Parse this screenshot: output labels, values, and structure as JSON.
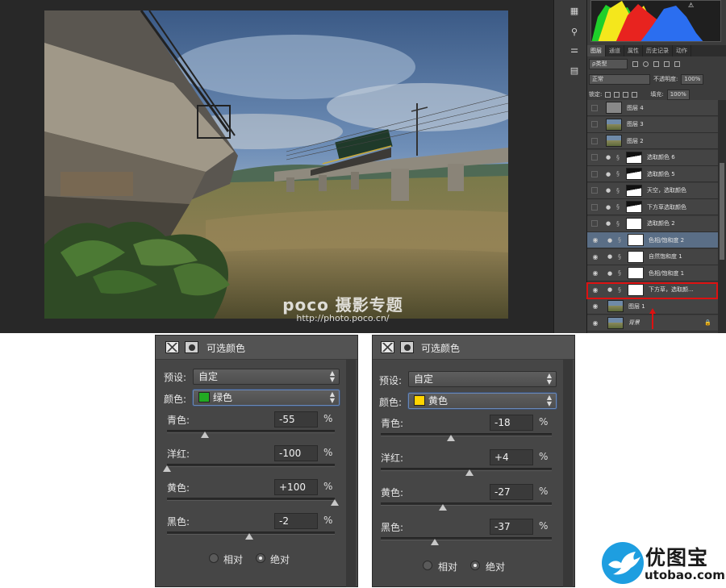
{
  "watermark": {
    "brand": "poco 摄影专题",
    "url": "http://photo.poco.cn/"
  },
  "layers_panel": {
    "tabs": [
      "图层",
      "通道",
      "属性",
      "历史记录",
      "动作"
    ],
    "filter_kind": "ρ类型",
    "blend_mode": "正常",
    "opacity_label": "不透明度:",
    "opacity_value": "100%",
    "lock_label": "锁定:",
    "fill_label": "填充:",
    "fill_value": "100%",
    "layers": [
      {
        "name": "图层 4",
        "visible": false,
        "thumb": "gray"
      },
      {
        "name": "图层 3",
        "visible": false,
        "thumb": "photo"
      },
      {
        "name": "图层 2",
        "visible": false,
        "thumb": "photo"
      },
      {
        "name": "选取颜色 6",
        "visible": false,
        "adjustment": true,
        "thumb": "mask"
      },
      {
        "name": "选取颜色 5",
        "visible": false,
        "adjustment": true,
        "thumb": "mask"
      },
      {
        "name": "天空，选取颜色",
        "visible": false,
        "adjustment": true,
        "thumb": "mask"
      },
      {
        "name": "下方草选取颜色",
        "visible": false,
        "adjustment": true,
        "thumb": "mask"
      },
      {
        "name": "选取颜色 2",
        "visible": false,
        "adjustment": true,
        "thumb": "white"
      },
      {
        "name": "色相/饱和度 2",
        "visible": true,
        "adjustment": true,
        "thumb": "white",
        "selected": true
      },
      {
        "name": "自然饱和度 1",
        "visible": true,
        "adjustment": true,
        "thumb": "white"
      },
      {
        "name": "色相/饱和度 1",
        "visible": true,
        "adjustment": true,
        "thumb": "white"
      },
      {
        "name": "下方草，选取颜...",
        "visible": true,
        "adjustment": true,
        "thumb": "white"
      },
      {
        "name": "图层 1",
        "visible": true,
        "thumb": "photo"
      },
      {
        "name": "背景",
        "visible": true,
        "thumb": "photo",
        "locked": true
      }
    ]
  },
  "dialogs": [
    {
      "title": "可选颜色",
      "preset_label": "预设:",
      "preset_value": "自定",
      "color_label": "颜色:",
      "color_value": "绿色",
      "color_swatch": "#22aa22",
      "sliders": [
        {
          "label": "青色:",
          "value": "-55",
          "level": -55
        },
        {
          "label": "洋红:",
          "value": "-100",
          "level": -100
        },
        {
          "label": "黄色:",
          "value": "+100",
          "level": 100
        },
        {
          "label": "黑色:",
          "value": "-2",
          "level": -2
        }
      ],
      "percent_sign": "%",
      "method_relative": "相对",
      "method_absolute": "绝对",
      "method_selected": "绝对"
    },
    {
      "title": "可选颜色",
      "preset_label": "预设:",
      "preset_value": "自定",
      "color_label": "颜色:",
      "color_value": "黄色",
      "color_swatch": "#ffd400",
      "sliders": [
        {
          "label": "青色:",
          "value": "-18",
          "level": -18
        },
        {
          "label": "洋红:",
          "value": "+4",
          "level": 4
        },
        {
          "label": "黄色:",
          "value": "-27",
          "level": -27
        },
        {
          "label": "黑色:",
          "value": "-37",
          "level": -37
        }
      ],
      "percent_sign": "%",
      "method_relative": "相对",
      "method_absolute": "绝对",
      "method_selected": "绝对"
    }
  ],
  "logo": {
    "name": "优图宝",
    "url": "utobao.com"
  }
}
